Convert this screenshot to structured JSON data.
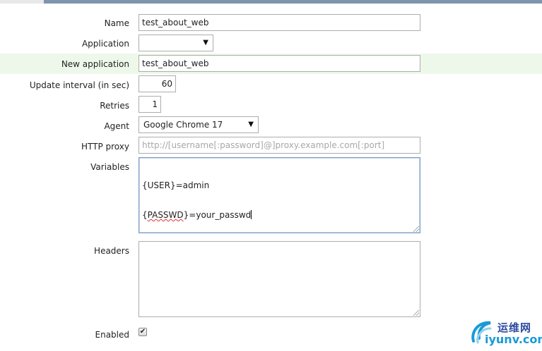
{
  "form": {
    "name": {
      "label": "Name",
      "value": "test_about_web"
    },
    "application": {
      "label": "Application",
      "selected": ""
    },
    "new_application": {
      "label": "New application",
      "value": "test_about_web"
    },
    "update_interval": {
      "label": "Update interval (in sec)",
      "value": "60"
    },
    "retries": {
      "label": "Retries",
      "value": "1"
    },
    "agent": {
      "label": "Agent",
      "selected": "Google Chrome 17"
    },
    "http_proxy": {
      "label": "HTTP proxy",
      "value": "",
      "placeholder": "http://[username[:password]@]proxy.example.com[:port]"
    },
    "variables": {
      "label": "Variables",
      "line1": "{USER}=admin",
      "line2_open": "{",
      "line2_misspelled": "PASSWD",
      "line2_rest": "}=your_passwd"
    },
    "headers": {
      "label": "Headers",
      "value": ""
    },
    "enabled": {
      "label": "Enabled",
      "checked": true,
      "check_glyph": "✔"
    }
  },
  "watermark": {
    "cn": "运维网",
    "en": "iyunv.com",
    "icon": "swirl-logo-icon"
  },
  "colors": {
    "highlight_row": "#eef8ea",
    "topbar": "#7e95ad",
    "focus_border": "#7a9cc0"
  }
}
